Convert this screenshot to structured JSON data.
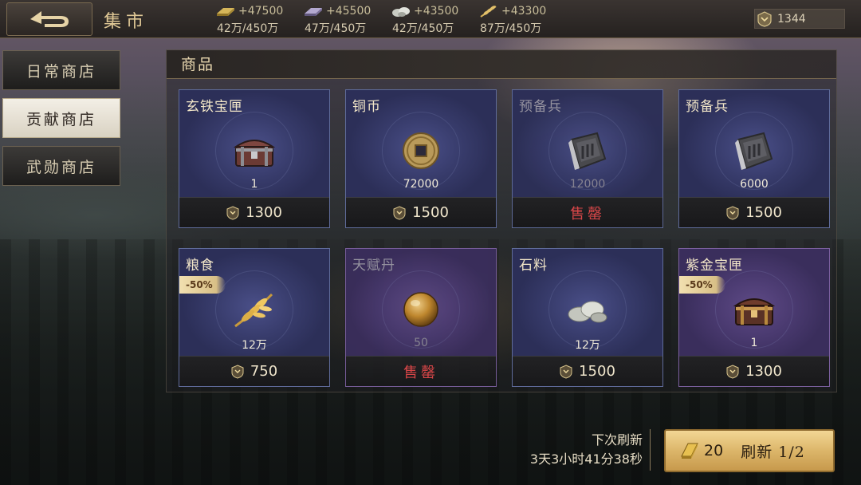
{
  "header": {
    "title": "集市",
    "back_icon": "back-arrow-icon"
  },
  "resources": [
    {
      "icon": "iron-ingot-icon",
      "amount": "+47500",
      "cap": "42万/450万",
      "color": "#c9a94a"
    },
    {
      "icon": "purple-ore-icon",
      "amount": "+45500",
      "cap": "47万/450万",
      "color": "#9a8fb6"
    },
    {
      "icon": "stone-icon",
      "amount": "+43500",
      "cap": "42万/450万",
      "color": "#b9bbb3"
    },
    {
      "icon": "wheat-icon",
      "amount": "+43300",
      "cap": "87万/450万",
      "color": "#d8b25a"
    }
  ],
  "merit": {
    "icon": "merit-badge-icon",
    "value": "1344"
  },
  "tabs": [
    {
      "label": "日常商店",
      "active": false
    },
    {
      "label": "贡献商店",
      "active": true
    },
    {
      "label": "武勋商店",
      "active": false
    }
  ],
  "panel": {
    "title": "商品"
  },
  "items": [
    {
      "name": "玄铁宝匣",
      "qty": "1",
      "price": "1300",
      "sold_out": false,
      "discount": "",
      "theme": "blue",
      "icon": "iron-chest-icon"
    },
    {
      "name": "铜币",
      "qty": "72000",
      "price": "1500",
      "sold_out": false,
      "discount": "",
      "theme": "blue",
      "icon": "copper-coin-icon"
    },
    {
      "name": "预备兵",
      "qty": "12000",
      "price": "",
      "sold_out": true,
      "discount": "",
      "theme": "blue",
      "icon": "reserve-soldiers-icon"
    },
    {
      "name": "预备兵",
      "qty": "6000",
      "price": "1500",
      "sold_out": false,
      "discount": "",
      "theme": "blue",
      "icon": "reserve-soldiers-icon"
    },
    {
      "name": "粮食",
      "qty": "12万",
      "price": "750",
      "sold_out": false,
      "discount": "-50%",
      "theme": "blue",
      "icon": "wheat-icon"
    },
    {
      "name": "天赋丹",
      "qty": "50",
      "price": "",
      "sold_out": true,
      "discount": "",
      "theme": "purple",
      "icon": "talent-pill-icon"
    },
    {
      "name": "石料",
      "qty": "12万",
      "price": "1500",
      "sold_out": false,
      "discount": "",
      "theme": "blue",
      "icon": "stone-icon"
    },
    {
      "name": "紫金宝匣",
      "qty": "1",
      "price": "1300",
      "sold_out": false,
      "discount": "-50%",
      "theme": "purple",
      "icon": "purple-gold-chest-icon"
    }
  ],
  "sold_out_label": "售罄",
  "refresh": {
    "label_line1": "下次刷新",
    "countdown": "3天3小时41分38秒",
    "cost": "20",
    "button_label": "刷新 1/2",
    "cost_icon": "gold-ingot-icon"
  }
}
